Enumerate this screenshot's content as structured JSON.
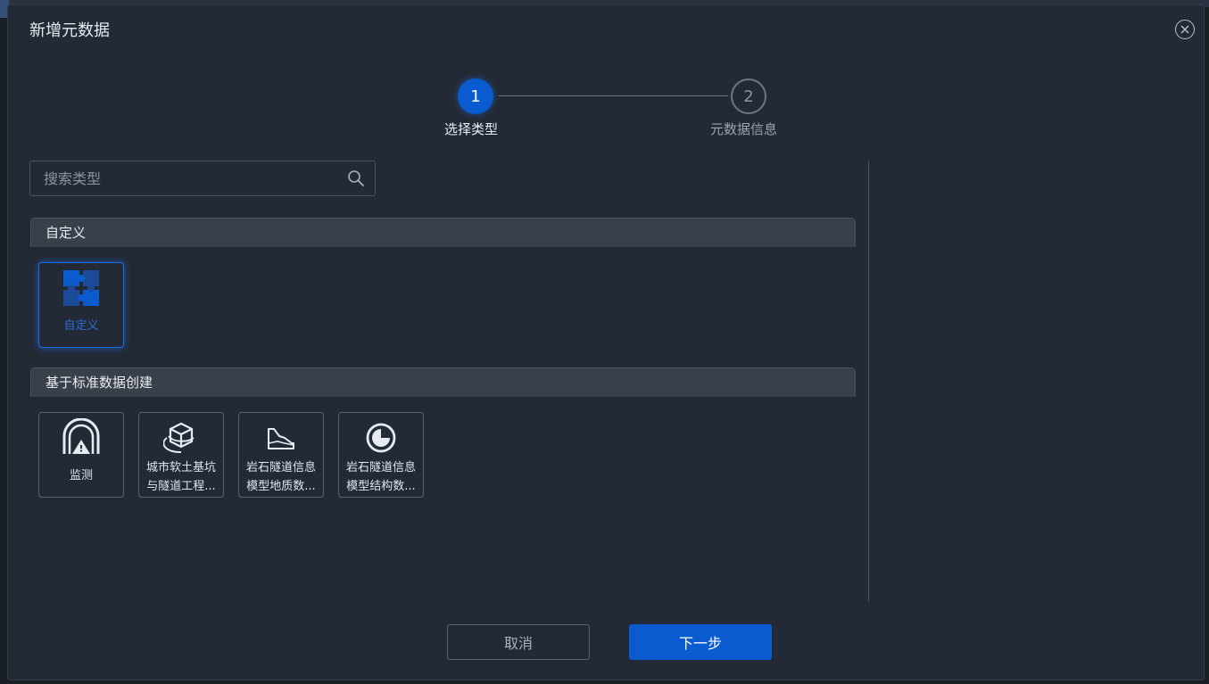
{
  "dialog": {
    "title": "新增元数据"
  },
  "steps": [
    {
      "number": "1",
      "label": "选择类型",
      "state": "active"
    },
    {
      "number": "2",
      "label": "元数据信息",
      "state": "pending"
    }
  ],
  "search": {
    "placeholder": "搜索类型",
    "value": ""
  },
  "sections": [
    {
      "title": "自定义",
      "cards": [
        {
          "label_lines": [
            "自定义"
          ],
          "icon": "puzzle-icon",
          "selected": true
        }
      ]
    },
    {
      "title": "基于标准数据创建",
      "cards": [
        {
          "label_lines": [
            "监测"
          ],
          "icon": "tunnel-icon",
          "selected": false
        },
        {
          "label_lines": [
            "城市软土基坑",
            "与隧道工程..."
          ],
          "icon": "cube-icon",
          "selected": false
        },
        {
          "label_lines": [
            "岩石隧道信息",
            "模型地质数..."
          ],
          "icon": "terrain-icon",
          "selected": false
        },
        {
          "label_lines": [
            "岩石隧道信息",
            "模型结构数..."
          ],
          "icon": "pie-icon",
          "selected": false
        }
      ]
    }
  ],
  "footer": {
    "cancel_label": "取消",
    "next_label": "下一步"
  },
  "colors": {
    "accent": "#0a5bd0",
    "dialog_bg": "#232a35",
    "section_header_bg": "#3a404a"
  }
}
